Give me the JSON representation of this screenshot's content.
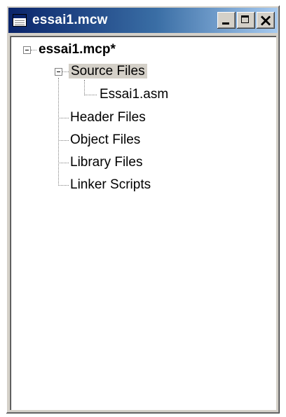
{
  "window": {
    "title": "essai1.mcw",
    "title_icon": "window-icon",
    "minimize_icon": "minimize-icon",
    "maximize_icon": "maximize-icon",
    "close_icon": "close-icon"
  },
  "tree": {
    "root": {
      "label": "essai1.mcp*",
      "expanded": true
    },
    "folders": [
      {
        "label": "Source Files",
        "expanded": true,
        "selected": true,
        "children": [
          {
            "label": "Essai1.asm"
          }
        ]
      },
      {
        "label": "Header Files"
      },
      {
        "label": "Object Files"
      },
      {
        "label": "Library Files"
      },
      {
        "label": "Linker Scripts"
      }
    ]
  }
}
